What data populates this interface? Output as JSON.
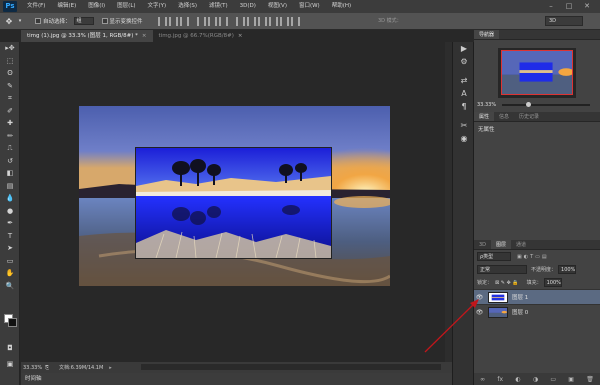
{
  "app": {
    "logo": "Ps"
  },
  "menu": [
    "文件(F)",
    "编辑(E)",
    "图像(I)",
    "图层(L)",
    "文字(Y)",
    "选择(S)",
    "滤镜(T)",
    "3D(D)",
    "视图(V)",
    "窗口(W)",
    "帮助(H)"
  ],
  "window_controls": [
    "–",
    "□",
    "✕"
  ],
  "options_bar": {
    "auto_select_label": "自动选择：",
    "auto_select_value": "组",
    "show_transform_label": "显示变换控件",
    "mode3d_label": "3D 模式：",
    "workspace_value": "3D"
  },
  "tools": [
    "move",
    "marquee",
    "lasso",
    "quick-select",
    "crop",
    "eyedropper",
    "healing",
    "brush",
    "stamp",
    "history-brush",
    "eraser",
    "gradient",
    "blur",
    "dodge",
    "pen",
    "text",
    "path-select",
    "shape",
    "hand",
    "zoom"
  ],
  "tool_glyphs": [
    "▸✥",
    "⬚",
    "ʘ",
    "✎",
    "⌗",
    "✐",
    "✚",
    "✏",
    "⎍",
    "↺",
    "◧",
    "▤",
    "💧",
    "●",
    "✒",
    "T",
    "➤",
    "▭",
    "✋",
    "🔍"
  ],
  "colors": {
    "foreground": "#ffffff",
    "background": "#111111",
    "accent_arrow": "#c0161b",
    "layer_selected": "#5b6a82"
  },
  "doc_tabs": [
    {
      "label": "timg (1).jpg @ 33.3% (图层 1, RGB/8#) *",
      "close": "×"
    },
    {
      "label": "timg.jpg @ 66.7%(RGB/8#)",
      "close": "×"
    }
  ],
  "status": {
    "zoom": "33.33%",
    "doc": "文档:6.39M/14.1M",
    "arrow": "▸"
  },
  "timeline": {
    "label": "时间轴"
  },
  "dock_icons": [
    "play-icon",
    "brush-settings-icon",
    "adjust-icon",
    "paragraph-icon",
    "character-icon",
    "tools-icon",
    "channels-icon"
  ],
  "dock_glyphs": [
    "▶",
    "⚙",
    "⇄",
    "A",
    "¶",
    "✂",
    "◉"
  ],
  "navigator": {
    "tab": "导航器",
    "zoom": "33.33%",
    "zoom_fraction": 0.27
  },
  "properties": {
    "tabs": [
      "属性",
      "信息",
      "历史记录"
    ],
    "body": "无属性"
  },
  "layers_panel": {
    "tabs": [
      "3D",
      "图层",
      "通道"
    ],
    "kind_label": "ρ类型",
    "blend_mode": "正常",
    "opacity_label": "不透明度：",
    "opacity_value": "100%",
    "lock_label": "锁定：",
    "lock_icons": "⊠ ✎ ✥ 🔒",
    "fill_label": "填充：",
    "fill_value": "100%",
    "layers": [
      {
        "name": "图层 1",
        "visible": true,
        "selected": true
      },
      {
        "name": "图层 0",
        "visible": true,
        "selected": false
      }
    ],
    "footer_icons": [
      "∞",
      "fx",
      "◐",
      "◑",
      "▭",
      "▣",
      "🗑"
    ]
  }
}
